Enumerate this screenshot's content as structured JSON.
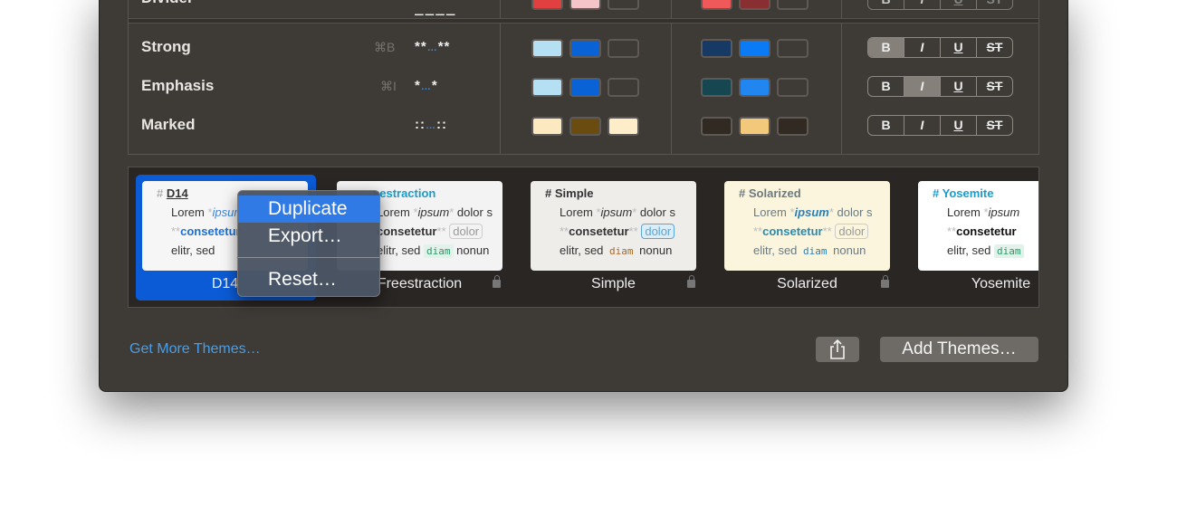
{
  "styles_table": {
    "divider_row": {
      "label": "Divider",
      "markup": "____",
      "swatches_light": [
        "#e0403f",
        "#f5c4c8",
        ""
      ],
      "swatches_dark": [
        "#f0595a",
        "#8a2f31",
        ""
      ]
    },
    "rows": [
      {
        "label": "Strong",
        "shortcut": "⌘B",
        "markup_a": "**",
        "markup_b": "…",
        "markup_c": "**",
        "swatches_light": [
          "#b5e0f3",
          "#0a63d6",
          ""
        ],
        "swatches_dark": [
          "#163a63",
          "#0b7bf5",
          ""
        ],
        "active": "B"
      },
      {
        "label": "Emphasis",
        "shortcut": "⌘I",
        "markup_a": "*",
        "markup_b": "…",
        "markup_c": "*",
        "swatches_light": [
          "#b5e0f3",
          "#0a63d6",
          ""
        ],
        "swatches_dark": [
          "#164650",
          "#2186f0",
          ""
        ],
        "active": "I"
      },
      {
        "label": "Marked",
        "shortcut": "",
        "markup_a": "::",
        "markup_b": "…",
        "markup_c": "::",
        "swatches_light": [
          "#fde9c0",
          "#6b4c10",
          "#fdeec9"
        ],
        "swatches_dark": [
          "#302a22",
          "#f2c97a",
          "#302a22"
        ],
        "active": ""
      }
    ],
    "format_buttons": [
      "B",
      "I",
      "U",
      "ST"
    ]
  },
  "themes": [
    {
      "name": "D14",
      "heading": "D14",
      "hash": "#",
      "selected": true,
      "locked": false
    },
    {
      "name": "Freestraction",
      "heading": "eestraction",
      "label_visible": "reestraction",
      "hash": "",
      "locked": true
    },
    {
      "name": "Simple",
      "heading": "Simple",
      "hash": "#",
      "locked": true
    },
    {
      "name": "Solarized",
      "heading": "Solarized",
      "hash": "#",
      "locked": true
    },
    {
      "name": "Yosemite",
      "heading": "Yosemite",
      "hash": "#",
      "locked": false
    }
  ],
  "preview": {
    "lorem": "Lorem",
    "ipsum": "ipsum",
    "dolor": "dolor s",
    "consetetur": "consetetur",
    "dolor2": "dolor",
    "elitr": "elitr, sed",
    "diam": "diam",
    "nonun": "nonun"
  },
  "context_menu": {
    "items": [
      "Duplicate",
      "Export…",
      "Reset…"
    ],
    "highlighted": "Duplicate"
  },
  "footer": {
    "get_more": "Get More Themes…",
    "add_themes": "Add Themes…",
    "share_icon": "share-icon"
  },
  "colors": {
    "accent": "#0b5bd6",
    "link": "#4a9ee8",
    "menu_highlight": "#2f7ae5"
  }
}
